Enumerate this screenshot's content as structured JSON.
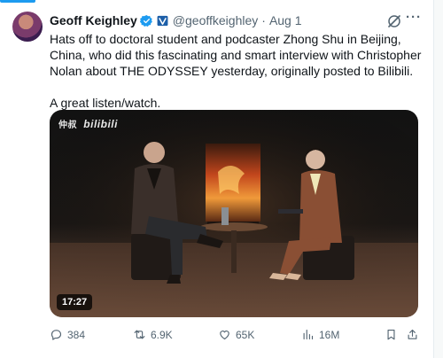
{
  "tweet": {
    "author_name": "Geoff Keighley",
    "handle": "@geoffkeighley",
    "separator": "·",
    "date": "Aug 1",
    "text_paragraph_1": "Hats off to doctoral student and podcaster Zhong Shu in Beijing, China, who did this fascinating and smart interview with Christopher Nolan about THE ODYSSEY yesterday, originally posted to Bilibili.",
    "text_paragraph_2": "A great listen/watch.",
    "more_label": "···"
  },
  "media": {
    "watermark_left": "仲叔",
    "watermark_brand": "bilibili",
    "duration": "17:27"
  },
  "actions": {
    "replies": "384",
    "retweets": "6.9K",
    "likes": "65K",
    "views": "16M"
  },
  "colors": {
    "accent": "#1d9bf0",
    "verified_blue": "#1d9bf0",
    "muted_text": "#536471",
    "text": "#0f1419"
  },
  "icons": {
    "verified": "verified-badge-icon",
    "affiliate": "affiliate-badge-icon",
    "grok": "grok-icon",
    "more": "more-icon",
    "reply": "reply-icon",
    "retweet": "retweet-icon",
    "like": "heart-icon",
    "views": "views-icon",
    "bookmark": "bookmark-icon",
    "share": "share-icon"
  }
}
